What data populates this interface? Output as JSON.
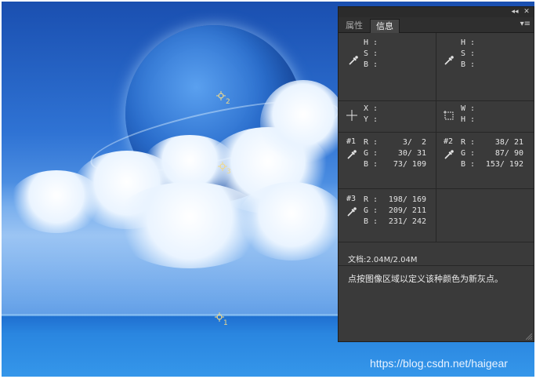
{
  "panel": {
    "tabs": [
      {
        "label": "属性",
        "active": false
      },
      {
        "label": "信息",
        "active": true
      }
    ],
    "collapse_glyph": "◂◂",
    "close_glyph": "✕",
    "menu_glyph": "▾≡",
    "hsb_left": {
      "h": "H :",
      "s": "S :",
      "b": "B :"
    },
    "hsb_right": {
      "h": "H :",
      "s": "S :",
      "b": "B :"
    },
    "xy": {
      "x": "X :",
      "y": "Y :"
    },
    "wh": {
      "w": "W :",
      "h": "H :"
    },
    "samplers": [
      {
        "id": "#1",
        "r": "3/  2",
        "g": "30/ 31",
        "b": "73/ 109"
      },
      {
        "id": "#2",
        "r": "38/ 21",
        "g": "87/ 90",
        "b": "153/ 192"
      },
      {
        "id": "#3",
        "r": "198/ 169",
        "g": "209/ 211",
        "b": "231/ 242"
      }
    ],
    "labels": {
      "r": "R :",
      "g": "G :",
      "b": "B :"
    },
    "document": "文档:2.04M/2.04M",
    "hint": "点按图像区域以定义该种颜色为新灰点。"
  },
  "canvas": {
    "markers": [
      {
        "num": "2"
      },
      {
        "num": "3"
      },
      {
        "num": "1"
      }
    ]
  },
  "watermark": "https://blog.csdn.net/haigear",
  "colors": {
    "panel_bg": "#3a3a3a",
    "marker": "#f0d98a",
    "sky": "#2f73d4"
  }
}
